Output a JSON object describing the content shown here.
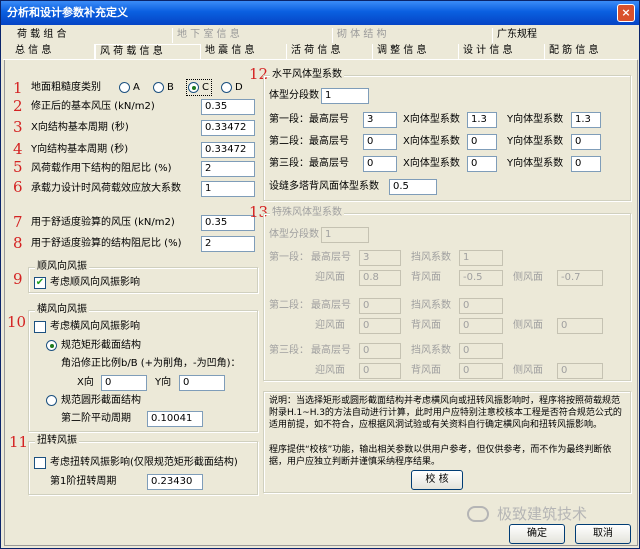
{
  "window": {
    "title": "分析和设计参数补充定义",
    "close_glyph": "×"
  },
  "tabs_row1": [
    {
      "label": "荷 载 组 合",
      "disabled": false
    },
    {
      "label": "地 下 室 信 息",
      "disabled": true
    },
    {
      "label": "砌 体 结 构",
      "disabled": true
    },
    {
      "label": "广东规程",
      "disabled": false
    }
  ],
  "tabs_row2": [
    {
      "label": "总  信  息"
    },
    {
      "label": "风 荷 载 信 息"
    },
    {
      "label": "地 震 信 息"
    },
    {
      "label": "活 荷 信 息"
    },
    {
      "label": "调 整 信 息"
    },
    {
      "label": "设 计 信 息"
    },
    {
      "label": "配 筋 信 息"
    }
  ],
  "markers": [
    "1",
    "2",
    "3",
    "4",
    "5",
    "6",
    "7",
    "8",
    "9",
    "10",
    "11",
    "12",
    "13"
  ],
  "terrain": {
    "label": "地面粗糙度类别",
    "options": [
      "A",
      "B",
      "C",
      "D"
    ],
    "selected": "C"
  },
  "fields": {
    "base_pressure": {
      "label": "修正后的基本风压 (kN/m2)",
      "value": "0.35"
    },
    "x_period": {
      "label": "X向结构基本周期 (秒)",
      "value": "0.33472"
    },
    "y_period": {
      "label": "Y向结构基本周期 (秒)",
      "value": "0.33472"
    },
    "damping": {
      "label": "风荷载作用下结构的阻尼比 (%)",
      "value": "2"
    },
    "amplify": {
      "label": "承载力设计时风荷载效应放大系数",
      "value": "1"
    },
    "comfort_pressure": {
      "label": "用于舒适度验算的风压 (kN/m2)",
      "value": "0.35"
    },
    "comfort_damping": {
      "label": "用于舒适度验算的结构阻尼比 (%)",
      "value": "2"
    }
  },
  "along_wind": {
    "title": "顺风向风振",
    "checkbox": "考虑顺风向风振影响",
    "checked": true,
    "check_glyph": "✔"
  },
  "cross_wind": {
    "title": "横风向风振",
    "checkbox": "考虑横风向风振影响",
    "rect_option": "规范矩形截面结构",
    "corner_label": "角沿修正比例b/B (+为削角，-为凹角)：",
    "x_label": "X向",
    "x_value": "0",
    "y_label": "Y向",
    "y_value": "0",
    "round_option": "规范圆形截面结构",
    "period_label": "第二阶平动周期",
    "period_value": "0.10041"
  },
  "torsion": {
    "title": "扭转风振",
    "checkbox": "考虑扭转风振影响(仅限规范矩形截面结构)",
    "period_label": "第1阶扭转周期",
    "period_value": "0.23430"
  },
  "shape": {
    "title": "水平风体型系数",
    "seg_label": "体型分段数",
    "seg_value": "1",
    "rows": [
      {
        "seg": "第一段：",
        "floor_label": "最高层号",
        "floor": "3",
        "x_label": "X向体型系数",
        "x": "1.3",
        "y_label": "Y向体型系数",
        "y": "1.3"
      },
      {
        "seg": "第二段：",
        "floor_label": "最高层号",
        "floor": "0",
        "x_label": "X向体型系数",
        "x": "0",
        "y_label": "Y向体型系数",
        "y": "0"
      },
      {
        "seg": "第三段：",
        "floor_label": "最高层号",
        "floor": "0",
        "x_label": "X向体型系数",
        "x": "0",
        "y_label": "Y向体型系数",
        "y": "0"
      }
    ],
    "parapet_label": "设缝多塔背风面体型系数",
    "parapet_value": "0.5"
  },
  "special": {
    "title": "特殊风体型系数",
    "seg_label": "体型分段数",
    "seg_value": "1",
    "rows": [
      {
        "seg": "第一段：",
        "floor_label": "最高层号",
        "floor": "3",
        "wind_label": "挡风系数",
        "wind": "1",
        "front_label": "迎风面",
        "front": "0.8",
        "back_label": "背风面",
        "back": "-0.5",
        "side_label": "侧风面",
        "side": "-0.7"
      },
      {
        "seg": "第二段：",
        "floor_label": "最高层号",
        "floor": "0",
        "wind_label": "挡风系数",
        "wind": "0",
        "front_label": "迎风面",
        "front": "0",
        "back_label": "背风面",
        "back": "0",
        "side_label": "侧风面",
        "side": "0"
      },
      {
        "seg": "第三段：",
        "floor_label": "最高层号",
        "floor": "0",
        "wind_label": "挡风系数",
        "wind": "0",
        "front_label": "迎风面",
        "front": "0",
        "back_label": "背风面",
        "back": "0",
        "side_label": "侧风面",
        "side": "0"
      }
    ]
  },
  "note1": "说明：当选择矩形或圆形截面结构并考虑横风向或扭转风振影响时，程序将按照荷载规范附录H.1~H.3的方法自动进行计算，此时用户应特别注意校核本工程是否符合规范公式的适用前提，如不符合，应根据风洞试验或有关资料自行确定横风向和扭转风振影响。",
  "note2": "程序提供“校核”功能，输出相关参数以供用户参考，但仅供参考，而不作为最终判断依据，用户应独立判断并谨慎采纳程序结果。",
  "check_button": "校  核",
  "watermark": "极致建筑技术",
  "buttons": {
    "ok": "确定",
    "cancel": "取消"
  }
}
